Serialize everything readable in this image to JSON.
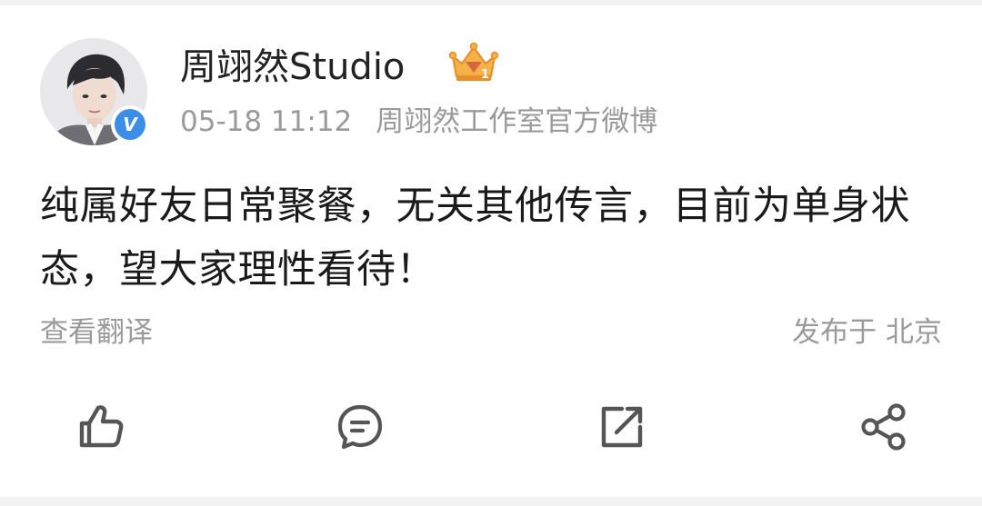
{
  "post": {
    "author": "周翊然Studio",
    "time": "05-18 11:12",
    "source": "周翊然工作室官方微博",
    "content": "纯属好友日常聚餐，无关其他传言，目前为单身状态，望大家理性看待！",
    "translate_label": "查看翻译",
    "location": "发布于 北京",
    "verified_badge": "V"
  },
  "icons": {
    "avatar": "avatar-photo",
    "verified": "verified-badge-icon",
    "crown": "crown-level-icon",
    "like": "thumbs-up-icon",
    "comment": "comment-icon",
    "repost": "repost-icon",
    "share": "share-icon"
  },
  "colors": {
    "text_primary": "#1a1a1a",
    "text_secondary": "#9a9a9a",
    "verified_blue": "#3b8ee8",
    "icon_gray": "#555555",
    "crown_gold": "#f2a93b"
  }
}
